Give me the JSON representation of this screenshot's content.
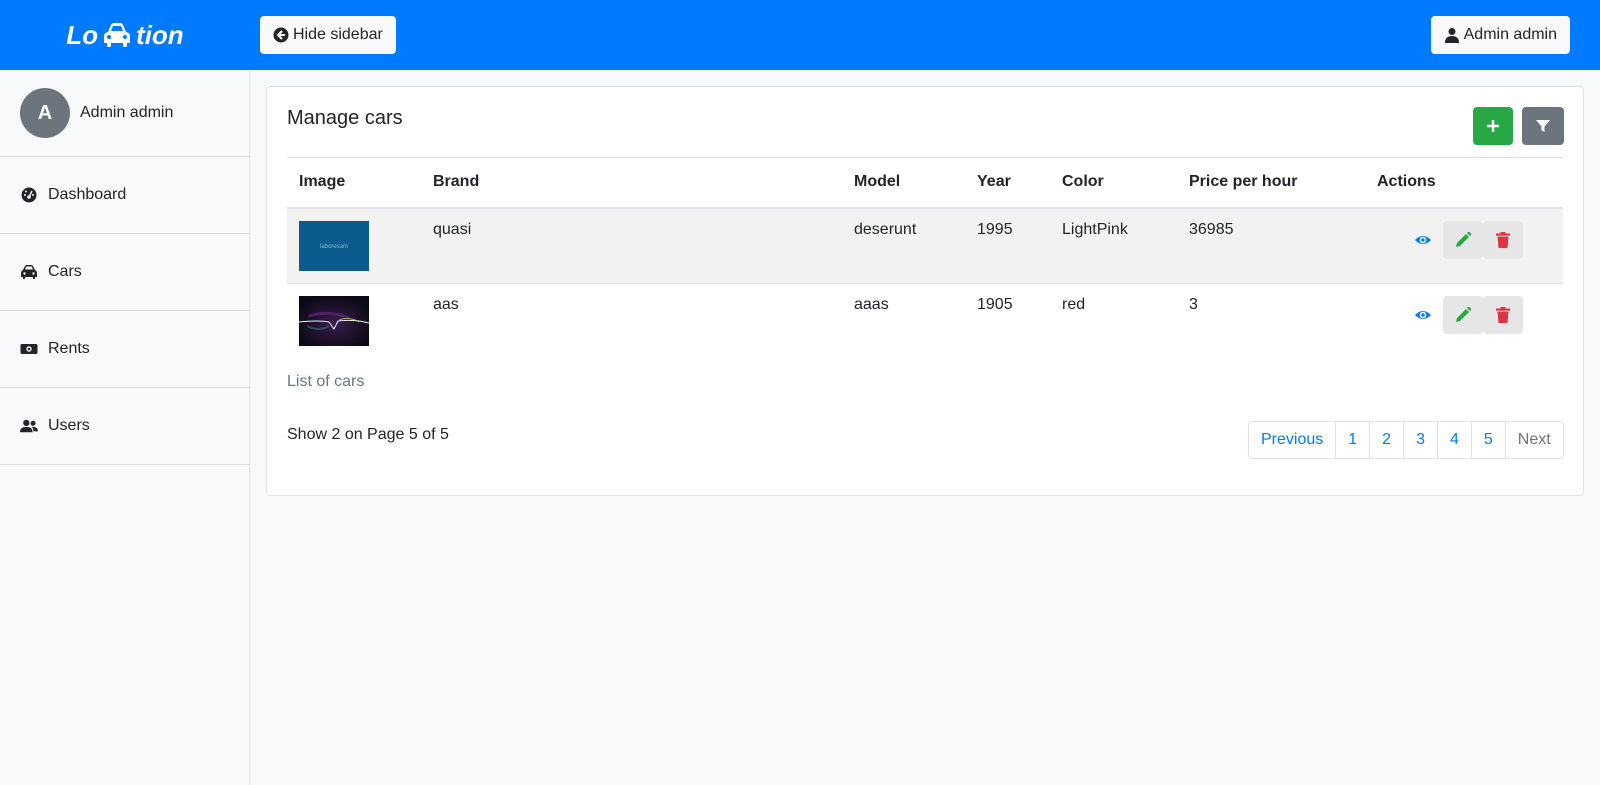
{
  "app": {
    "brand_left": "Lo",
    "brand_right": "tion",
    "brand_icon": "car-icon"
  },
  "header": {
    "hide_sidebar_label": "Hide sidebar",
    "user_label": "Admin admin"
  },
  "sidebar": {
    "profile": {
      "initial": "A",
      "name": "Admin admin"
    },
    "items": [
      {
        "label": "Dashboard",
        "icon": "tachometer-icon"
      },
      {
        "label": "Cars",
        "icon": "car-icon"
      },
      {
        "label": "Rents",
        "icon": "money-bill-icon"
      },
      {
        "label": "Users",
        "icon": "users-icon"
      }
    ]
  },
  "main": {
    "title": "Manage cars",
    "columns": [
      "Image",
      "Brand",
      "Model",
      "Year",
      "Color",
      "Price per hour",
      "Actions"
    ],
    "rows": [
      {
        "image_text": "laboresam",
        "brand": "quasi",
        "model": "deserunt",
        "year": "1995",
        "color": "LightPink",
        "price": "36985"
      },
      {
        "image_text": "",
        "brand": "aas",
        "model": "aaas",
        "year": "1905",
        "color": "red",
        "price": "3"
      }
    ],
    "caption": "List of cars",
    "summary": "Show 2 on Page 5 of 5",
    "pagination": {
      "previous": "Previous",
      "pages": [
        "1",
        "2",
        "3",
        "4",
        "5"
      ],
      "next": "Next"
    }
  },
  "colors": {
    "primary": "#007bff",
    "success": "#28a745",
    "danger": "#dc3545",
    "secondary": "#6c757d"
  }
}
